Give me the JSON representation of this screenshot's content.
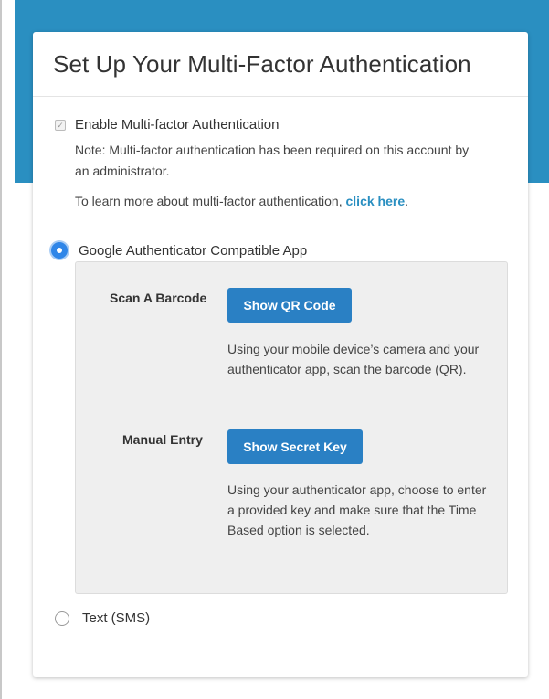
{
  "card": {
    "title": "Set Up Your Multi-Factor Authentication"
  },
  "mfa": {
    "enable_label": "Enable Multi-factor Authentication",
    "enabled": true,
    "note": "Note: Multi-factor authentication has been required on this account by an administrator.",
    "learn_more_text": "To learn more about multi-factor authentication, ",
    "learn_more_link": "click here",
    "learn_more_suffix": "."
  },
  "methods": {
    "app": {
      "label": "Google Authenticator Compatible App",
      "selected": true,
      "barcode": {
        "label": "Scan A Barcode",
        "button": "Show QR Code",
        "description": "Using your mobile device’s camera and your authenticator app, scan the barcode (QR)."
      },
      "manual": {
        "label": "Manual Entry",
        "button": "Show Secret Key",
        "description": "Using your authenticator app, choose to enter a provided key and make sure that the Time Based option is selected."
      }
    },
    "sms": {
      "label": "Text (SMS)",
      "selected": false
    }
  },
  "colors": {
    "accent": "#2a8fc1",
    "button": "#2a80c4",
    "radio_selected": "#2f86e8"
  }
}
